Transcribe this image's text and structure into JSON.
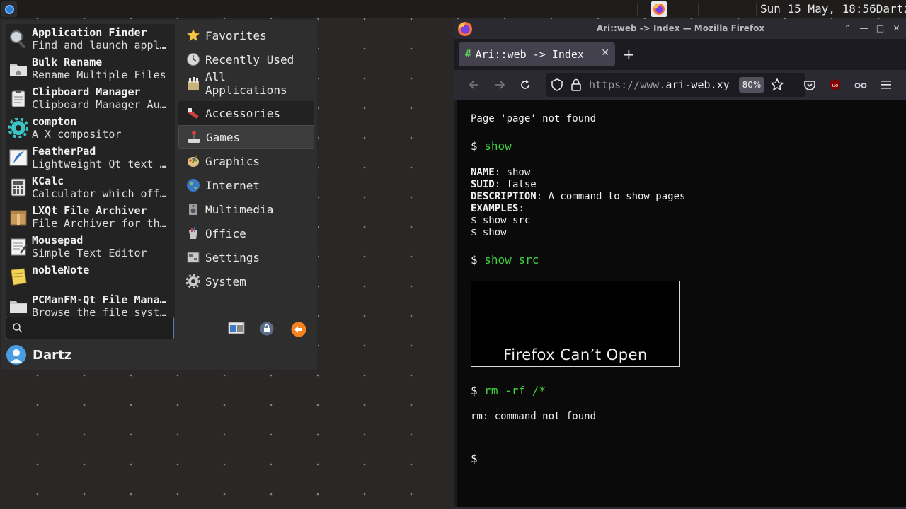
{
  "top_panel": {
    "clock": "Sun 15 May, 18:56",
    "user_tail": "Dartz"
  },
  "app_menu": {
    "apps": [
      {
        "name": "Application Finder",
        "desc": "Find and launch appl…",
        "icon": "magnifier-icon"
      },
      {
        "name": "Bulk Rename",
        "desc": "Rename Multiple Files",
        "icon": "folder-icon"
      },
      {
        "name": "Clipboard Manager",
        "desc": "Clipboard Manager Au…",
        "icon": "clipboard-icon"
      },
      {
        "name": "compton",
        "desc": "A X compositor",
        "icon": "gear-icon"
      },
      {
        "name": "FeatherPad",
        "desc": "Lightweight Qt text …",
        "icon": "feather-icon"
      },
      {
        "name": "KCalc",
        "desc": "Calculator which off…",
        "icon": "calculator-icon"
      },
      {
        "name": "LXQt File Archiver",
        "desc": "File Archiver for th…",
        "icon": "archive-icon"
      },
      {
        "name": "Mousepad",
        "desc": "Simple Text Editor",
        "icon": "notepad-icon"
      },
      {
        "name": "nobleNote",
        "desc": "",
        "icon": "note-icon"
      },
      {
        "name": "PCManFM-Qt File Mana…",
        "desc": "Browse the file syst…",
        "icon": "folder-icon"
      }
    ],
    "search": {
      "value": "",
      "placeholder": ""
    },
    "user_name": "Dartz",
    "top_categories": [
      {
        "label": "Favorites",
        "icon": "star-icon"
      },
      {
        "label": "Recently Used",
        "icon": "clock-icon"
      },
      {
        "label": "All Applications",
        "icon": "apps-icon"
      }
    ],
    "categories": [
      {
        "label": "Accessories",
        "icon": "accessories-icon"
      },
      {
        "label": "Games",
        "icon": "games-icon"
      },
      {
        "label": "Graphics",
        "icon": "palette-icon"
      },
      {
        "label": "Internet",
        "icon": "globe-icon"
      },
      {
        "label": "Multimedia",
        "icon": "multimedia-icon"
      },
      {
        "label": "Office",
        "icon": "office-icon"
      },
      {
        "label": "Settings",
        "icon": "settings-icon"
      },
      {
        "label": "System",
        "icon": "system-gear-icon"
      }
    ]
  },
  "firefox": {
    "window_title": "Ari::web -> Index — Mozilla Firefox",
    "tab_label": "Ari::web -> Index",
    "url_prefix": "https://www.",
    "url_domain": "ari-web.xy",
    "zoom": "80%"
  },
  "terminal": {
    "line_not_found": "Page 'page' not found",
    "prompt": "$",
    "cmd_show": "show",
    "name_key": "NAME",
    "name_val": ": show",
    "suid_key": "SUID",
    "suid_val": ": false",
    "desc_key": "DESCRIPTION",
    "desc_val": ": A command to show pages",
    "examples_key": "EXAMPLES",
    "examples_val": ":",
    "example_1": "$ show src",
    "example_2": "$ show",
    "cmd_show_src": "show src",
    "frame_text": "Firefox Can’t Open",
    "cmd_rm": "rm -rf /*",
    "rm_output": "rm: command not found",
    "final_prompt": "$"
  },
  "colors": {
    "prompt_green": "#3fcf3f",
    "accent_blue": "#4a7fb8"
  }
}
